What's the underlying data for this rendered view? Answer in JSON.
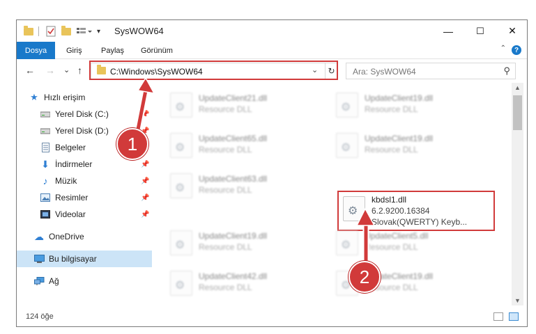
{
  "window": {
    "title": "SysWOW64",
    "buttons": {
      "minimize": "—",
      "maximize": "☐",
      "close": "✕"
    }
  },
  "ribbon": {
    "tabs": [
      {
        "label": "Dosya",
        "active": true
      },
      {
        "label": "Giriş"
      },
      {
        "label": "Paylaş"
      },
      {
        "label": "Görünüm"
      }
    ],
    "help": "?"
  },
  "nav": {
    "back": "←",
    "forward": "→",
    "recent": "⌄",
    "up": "↑",
    "address": "C:\\Windows\\SysWOW64",
    "search_placeholder": "Ara: SysWOW64"
  },
  "sidebar": {
    "items": [
      {
        "label": "Hızlı erişim",
        "icon": "star-icon",
        "pinned": false
      },
      {
        "label": "Yerel Disk (C:)",
        "icon": "drive-icon",
        "pinned": true
      },
      {
        "label": "Yerel Disk (D:)",
        "icon": "drive-icon",
        "pinned": true
      },
      {
        "label": "Belgeler",
        "icon": "documents-icon",
        "pinned": true
      },
      {
        "label": "İndirmeler",
        "icon": "download-icon",
        "pinned": true
      },
      {
        "label": "Müzik",
        "icon": "music-icon",
        "pinned": true
      },
      {
        "label": "Resimler",
        "icon": "pictures-icon",
        "pinned": true
      },
      {
        "label": "Videolar",
        "icon": "videos-icon",
        "pinned": true
      },
      {
        "label": "OneDrive",
        "icon": "cloud-icon",
        "pinned": false
      },
      {
        "label": "Bu bilgisayar",
        "icon": "computer-icon",
        "pinned": false,
        "selected": true
      },
      {
        "label": "Ağ",
        "icon": "network-icon",
        "pinned": false
      }
    ]
  },
  "files": [
    {
      "name": "UpdateClient21.dll",
      "type": "Resource DLL"
    },
    {
      "name": "UpdateClient19.dll",
      "type": "Resource DLL"
    },
    {
      "name": "UpdateClient65.dll",
      "type": "Resource DLL"
    },
    {
      "name": "UpdateClient19.dll",
      "type": "Resource DLL"
    },
    {
      "name": "UpdateClient63.dll",
      "type": "Resource DLL"
    },
    {
      "name": "kbdsl1.dll",
      "version": "6.2.9200.16384",
      "desc": "Slovak(QWERTY) Keyb...",
      "highlighted": true
    },
    {
      "name": "UpdateClient19.dll",
      "type": "Resource DLL"
    },
    {
      "name": "UpdateClient5.dll",
      "type": "Resource DLL"
    },
    {
      "name": "UpdateClient42.dll",
      "type": "Resource DLL"
    },
    {
      "name": "UpdateClient19.dll",
      "type": "Resource DLL"
    }
  ],
  "status": {
    "item_count": "124 öğe"
  },
  "annotations": {
    "marker1": "1",
    "marker2": "2",
    "highlight_color": "#d13a3a"
  }
}
